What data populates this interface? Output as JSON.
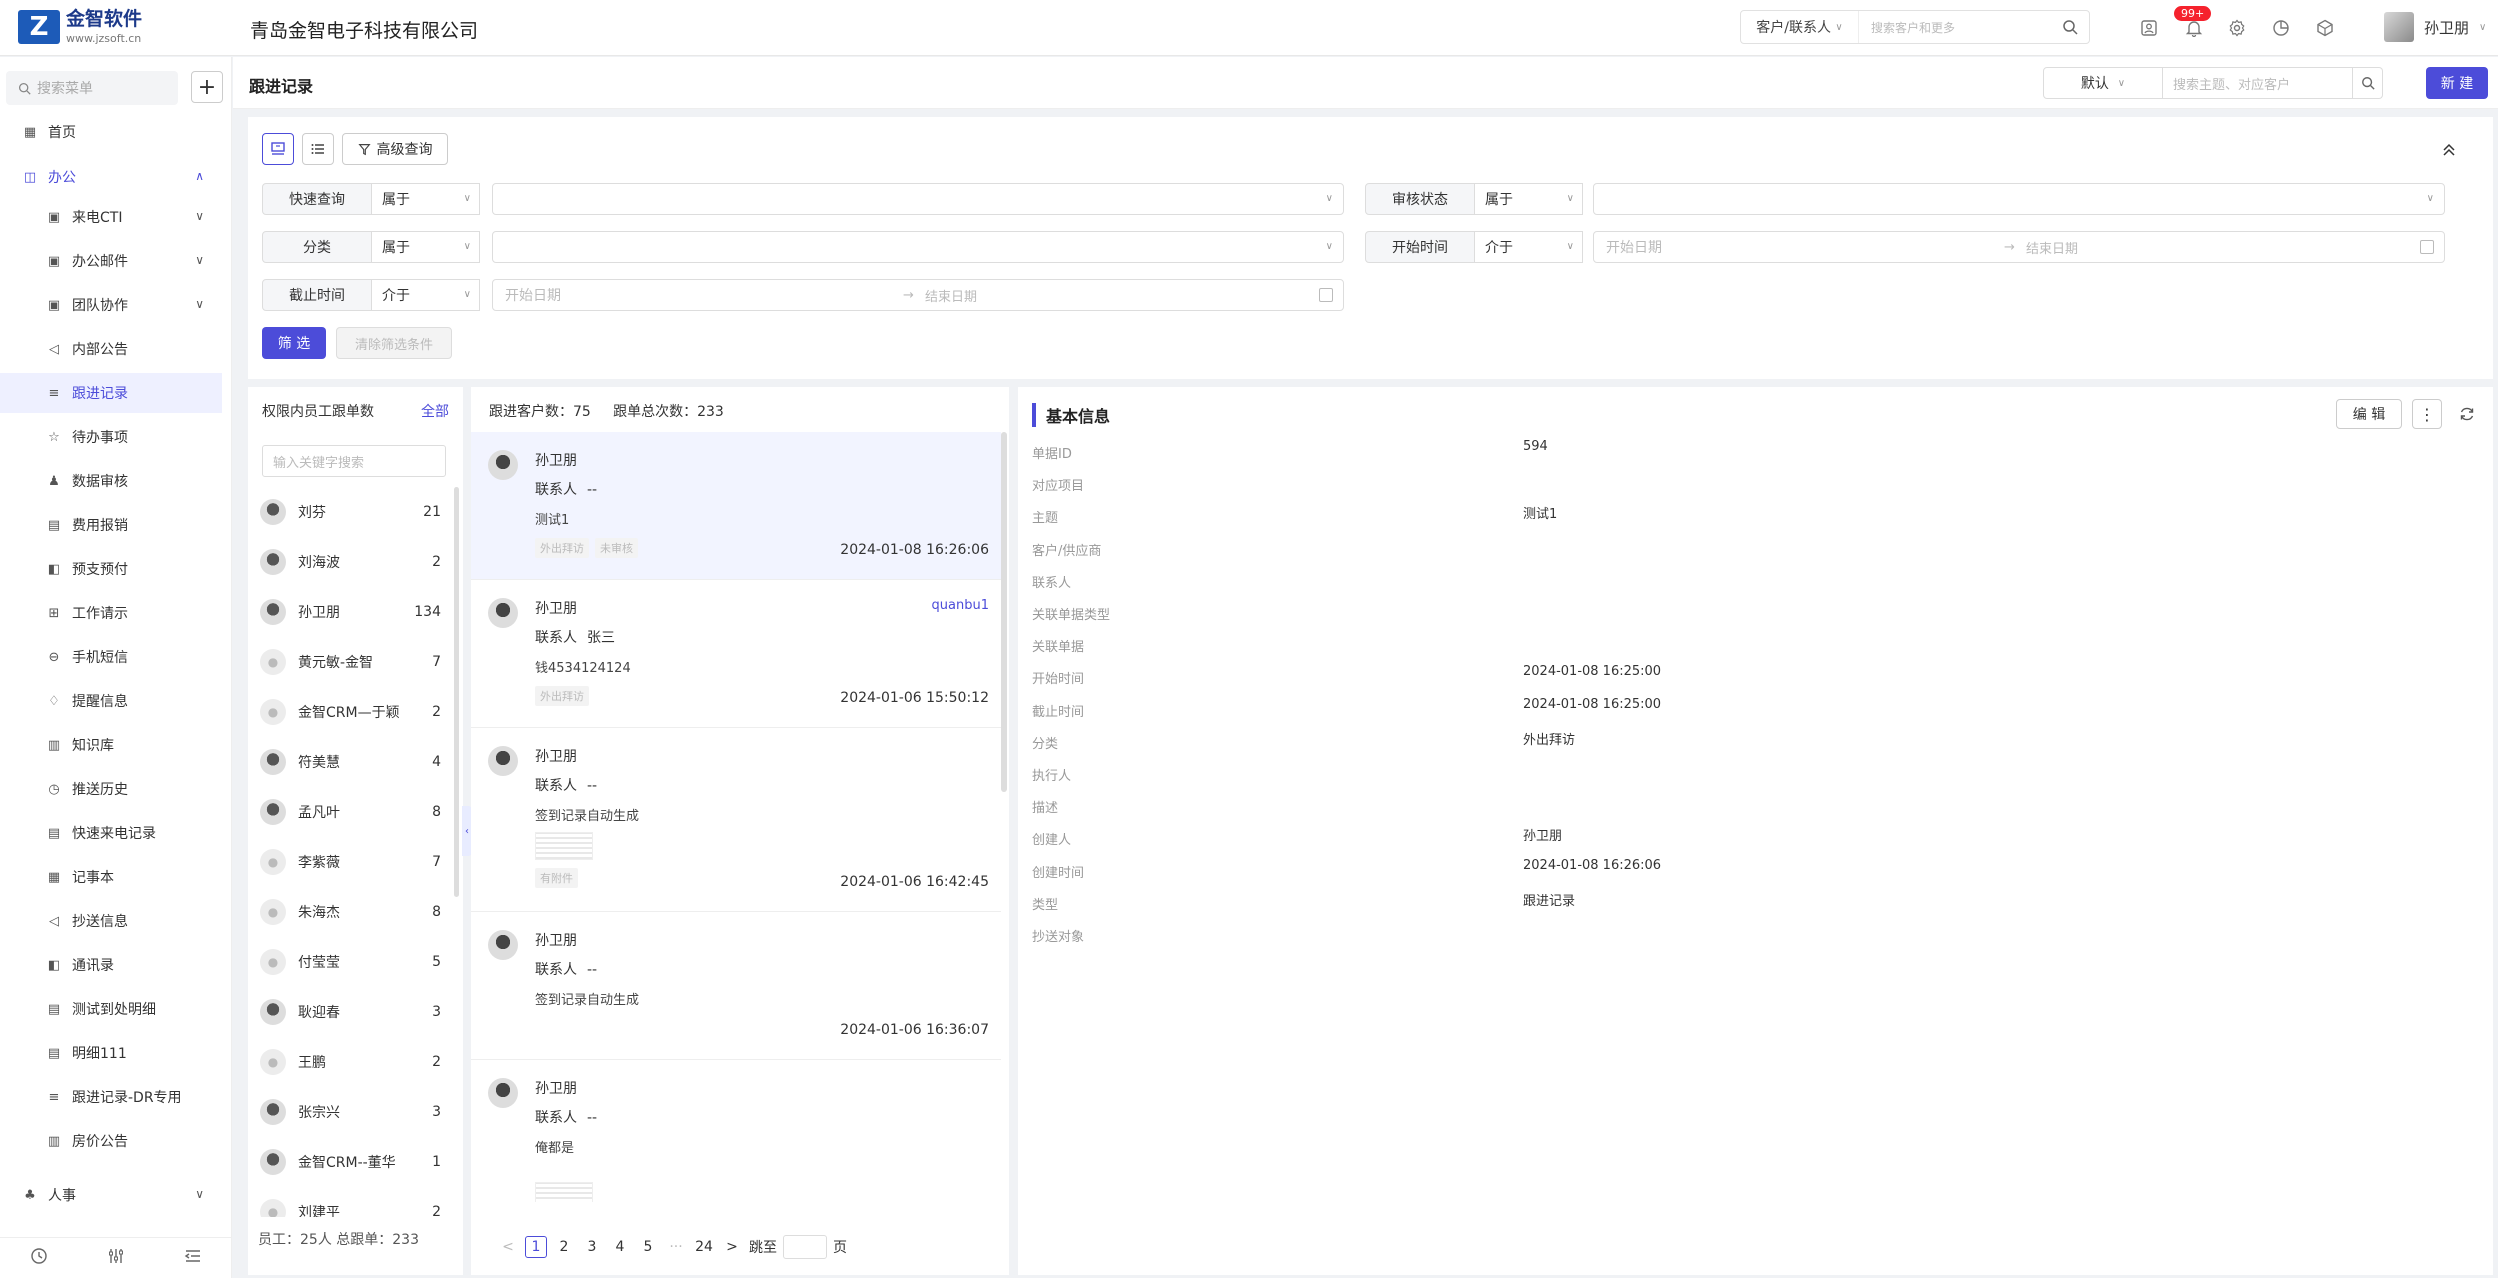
{
  "brand": {
    "name": "金智软件",
    "url": "www.jzsoft.cn",
    "logo_letter": "Z"
  },
  "company": "青岛金智电子科技有限公司",
  "global_search": {
    "type": "客户/联系人",
    "placeholder": "搜索客户和更多"
  },
  "notifications": {
    "badge": "99+"
  },
  "user": {
    "name": "孙卫朋"
  },
  "sidebar": {
    "search_placeholder": "搜索菜单",
    "add_label": "+",
    "home": "首页",
    "office": "办公",
    "items": [
      "来电CTI",
      "办公邮件",
      "团队协作",
      "内部公告",
      "跟进记录",
      "待办事项",
      "数据审核",
      "费用报销",
      "预支预付",
      "工作请示",
      "手机短信",
      "提醒信息",
      "知识库",
      "推送历史",
      "快速来电记录",
      "记事本",
      "抄送信息",
      "通讯录",
      "测试到处明细",
      "明细111",
      "跟进记录-DR专用",
      "房价公告"
    ],
    "hr": "人事"
  },
  "page": {
    "title": "跟进记录",
    "view": "默认",
    "search_placeholder": "搜索主题、对应客户",
    "new_button": "新 建"
  },
  "filters": {
    "advanced": "高级查询",
    "rows": [
      {
        "label": "快速查询",
        "op": "属于"
      },
      {
        "label": "审核状态",
        "op": "属于"
      },
      {
        "label": "分类",
        "op": "属于"
      },
      {
        "label": "开始时间",
        "op": "介于",
        "start": "开始日期",
        "end": "结束日期"
      },
      {
        "label": "截止时间",
        "op": "介于",
        "start": "开始日期",
        "end": "结束日期"
      }
    ],
    "submit": "筛 选",
    "clear": "清除筛选条件"
  },
  "employees": {
    "title": "权限内员工跟单数",
    "all_label": "全部",
    "search_placeholder": "输入关键字搜索",
    "rows": [
      {
        "name": "刘芬",
        "count": "21"
      },
      {
        "name": "刘海波",
        "count": "2"
      },
      {
        "name": "孙卫朋",
        "count": "134"
      },
      {
        "name": "黄元敏-金智",
        "count": "7"
      },
      {
        "name": "金智CRM—于颖",
        "count": "2"
      },
      {
        "name": "符美慧",
        "count": "4"
      },
      {
        "name": "孟凡叶",
        "count": "8"
      },
      {
        "name": "李紫薇",
        "count": "7"
      },
      {
        "name": "朱海杰",
        "count": "8"
      },
      {
        "name": "付莹莹",
        "count": "5"
      },
      {
        "name": "耿迎春",
        "count": "3"
      },
      {
        "name": "王鹏",
        "count": "2"
      },
      {
        "name": "张宗兴",
        "count": "3"
      },
      {
        "name": "金智CRM--董华",
        "count": "1"
      },
      {
        "name": "刘建平",
        "count": "2"
      }
    ],
    "footer": "员工：25人 总跟单：233"
  },
  "records": {
    "stats": {
      "customers_label": "跟进客户数：",
      "customers": "75",
      "total_label": "跟单总次数：",
      "total": "233"
    },
    "contact_label": "联系人",
    "items": [
      {
        "name": "孙卫朋",
        "contact": "--",
        "subject": "测试1",
        "tags": [
          "外出拜访",
          "未审核"
        ],
        "time": "2024-01-08 16:26:06",
        "extra": ""
      },
      {
        "name": "孙卫朋",
        "contact": "张三",
        "subject": "钱4534124124",
        "tags": [
          "外出拜访"
        ],
        "time": "2024-01-06 15:50:12",
        "extra": "quanbu1"
      },
      {
        "name": "孙卫朋",
        "contact": "--",
        "subject": "签到记录自动生成",
        "tags": [
          "有附件"
        ],
        "time": "2024-01-06 16:42:45",
        "extra": ""
      },
      {
        "name": "孙卫朋",
        "contact": "--",
        "subject": "签到记录自动生成",
        "tags": [],
        "time": "2024-01-06 16:36:07",
        "extra": ""
      },
      {
        "name": "孙卫朋",
        "contact": "--",
        "subject": "俺都是",
        "tags": [],
        "time": "",
        "extra": ""
      }
    ],
    "pager": {
      "prev": "<",
      "pages": [
        "1",
        "2",
        "3",
        "4",
        "5"
      ],
      "ellipsis": "···",
      "last": "24",
      "next": ">",
      "jump": "跳至",
      "page_unit": "页"
    }
  },
  "detail": {
    "title": "基本信息",
    "edit": "编 辑",
    "fields": [
      {
        "label": "单据ID",
        "value": "594"
      },
      {
        "label": "对应项目",
        "value": ""
      },
      {
        "label": "主题",
        "value": "测试1"
      },
      {
        "label": "客户/供应商",
        "value": ""
      },
      {
        "label": "联系人",
        "value": ""
      },
      {
        "label": "关联单据类型",
        "value": ""
      },
      {
        "label": "关联单据",
        "value": ""
      },
      {
        "label": "开始时间",
        "value": "2024-01-08 16:25:00"
      },
      {
        "label": "截止时间",
        "value": "2024-01-08 16:25:00"
      },
      {
        "label": "分类",
        "value": "外出拜访"
      },
      {
        "label": "执行人",
        "value": ""
      },
      {
        "label": "描述",
        "value": ""
      },
      {
        "label": "创建人",
        "value": "孙卫朋"
      },
      {
        "label": "创建时间",
        "value": "2024-01-08 16:26:06"
      },
      {
        "label": "类型",
        "value": "跟进记录"
      },
      {
        "label": "抄送对象",
        "value": ""
      }
    ]
  },
  "colors": {
    "accent": "#4c4cd9",
    "badge": "#f5222d",
    "brand": "#1d5bb8"
  }
}
